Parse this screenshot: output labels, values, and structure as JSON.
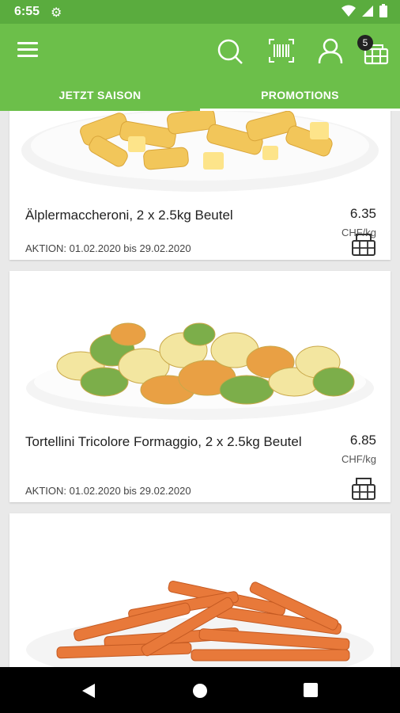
{
  "status_bar": {
    "time": "6:55"
  },
  "app_bar": {
    "cart_count": "5"
  },
  "tabs": [
    {
      "label": "JETZT SAISON",
      "active": false
    },
    {
      "label": "PROMOTIONS",
      "active": true
    }
  ],
  "products": [
    {
      "title": "Älplermaccheroni, 2 x 2.5kg Beutel",
      "price": "6.35",
      "unit": "CHF/kg",
      "promo": "AKTION: 01.02.2020 bis 29.02.2020"
    },
    {
      "title": "Tortellini Tricolore Formaggio, 2 x 2.5kg Beutel",
      "price": "6.85",
      "unit": "CHF/kg",
      "promo": "AKTION: 01.02.2020 bis 29.02.2020"
    },
    {
      "title": "",
      "price": "",
      "unit": "",
      "promo": ""
    }
  ],
  "colors": {
    "appbar": "#6cbf4a",
    "statusbar": "#5aac3e"
  }
}
